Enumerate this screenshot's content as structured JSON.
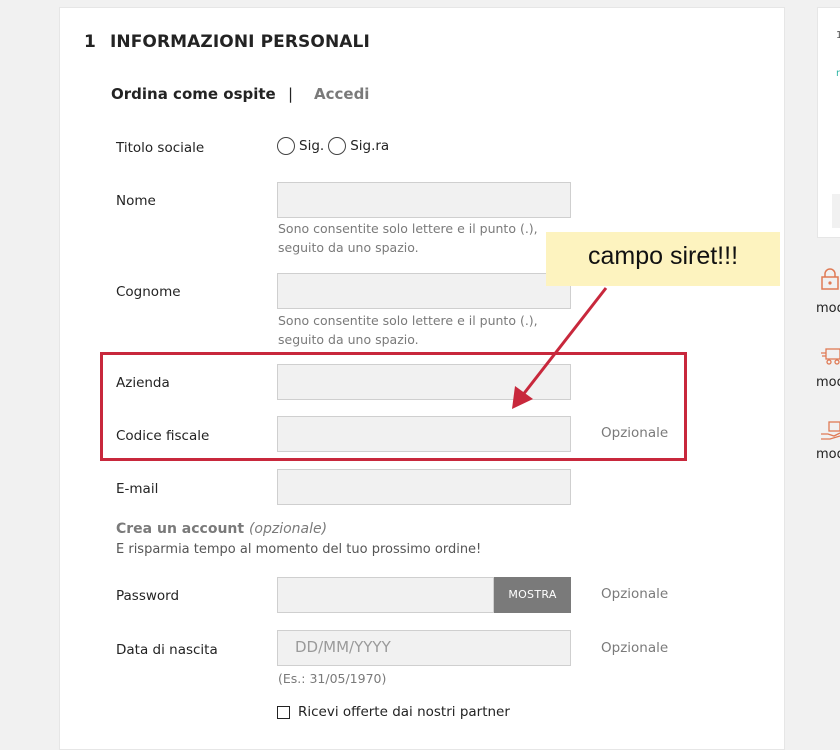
{
  "section": {
    "number": "1",
    "title": "INFORMAZIONI PERSONALI"
  },
  "tabs": {
    "guest": "Ordina come ospite",
    "separator": "|",
    "login": "Accedi"
  },
  "form": {
    "title_label": "Titolo sociale",
    "title_options": [
      "Sig.",
      "Sig.ra"
    ],
    "name_label": "Nome",
    "name_hint": "Sono consentite solo lettere e il punto (.), seguito da uno spazio.",
    "surname_label": "Cognome",
    "surname_hint": "Sono consentite solo lettere e il punto (.), seguito da uno spazio.",
    "company_label": "Azienda",
    "fiscal_code_label": "Codice fiscale",
    "fiscal_code_optional": "Opzionale",
    "email_label": "E-mail",
    "create_account_title": "Crea un account",
    "create_account_optional": "(opzionale)",
    "create_account_subtitle": "E risparmia tempo al momento del tuo prossimo ordine!",
    "password_label": "Password",
    "password_show": "MOSTRA",
    "password_optional": "Opzionale",
    "birthdate_label": "Data di nascita",
    "birthdate_placeholder": "DD/MM/YYYY",
    "birthdate_example": "(Es.: 31/05/1970)",
    "birthdate_optional": "Opzionale",
    "partner_offers_label": "Ricevi offerte dai nostri partner"
  },
  "annotation": {
    "note_text": "campo siret!!!",
    "color": "#c8283c",
    "note_bg": "#fdf3bf"
  },
  "sidebar": {
    "items": [
      {
        "icon": "lock-icon",
        "text": "mod"
      },
      {
        "icon": "truck-icon",
        "text": "mod"
      },
      {
        "icon": "hand-package-icon",
        "text": "mod"
      }
    ],
    "accent": "#e07a55"
  }
}
